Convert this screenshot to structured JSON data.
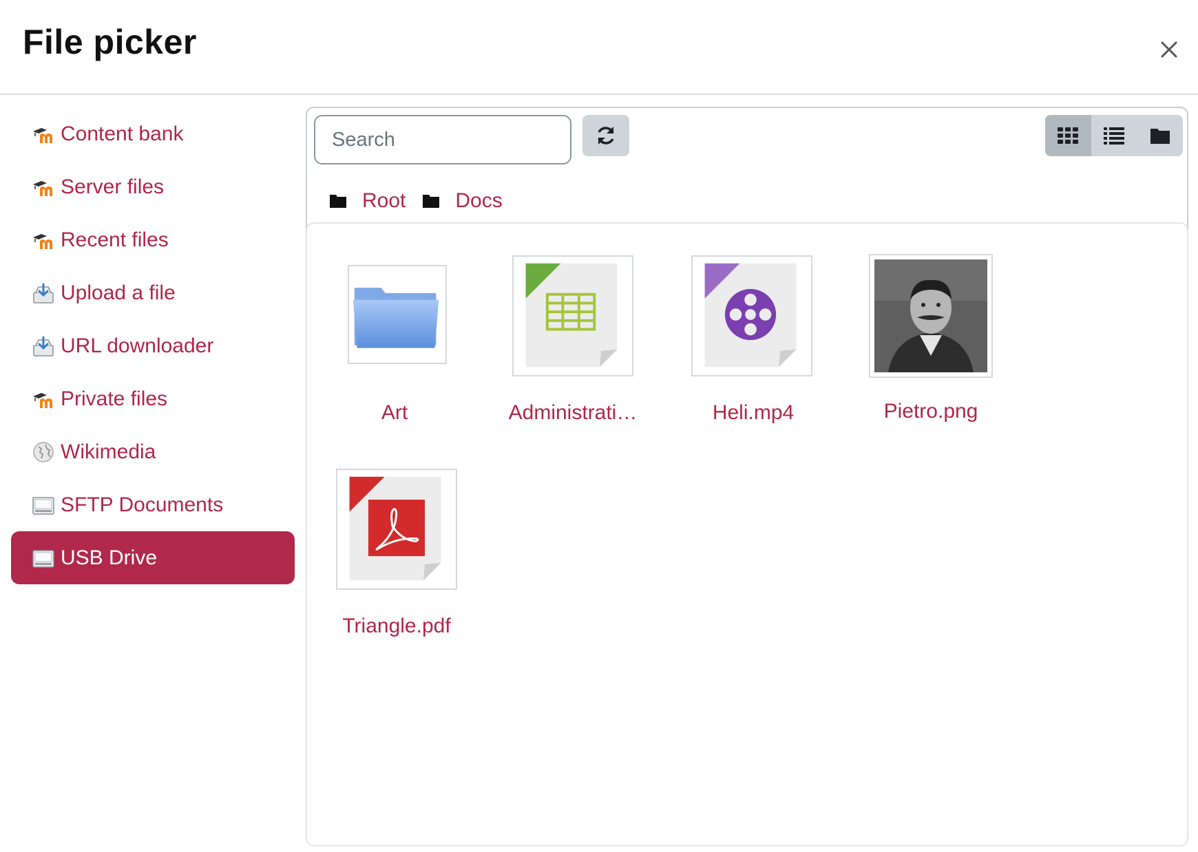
{
  "dialog": {
    "title": "File picker",
    "close_icon": "close-icon"
  },
  "sidebar": {
    "items": [
      {
        "label": "Content bank",
        "icon": "moodle-icon",
        "active": false
      },
      {
        "label": "Server files",
        "icon": "moodle-icon",
        "active": false
      },
      {
        "label": "Recent files",
        "icon": "moodle-icon",
        "active": false
      },
      {
        "label": "Upload a file",
        "icon": "upload-icon",
        "active": false
      },
      {
        "label": "URL downloader",
        "icon": "upload-icon",
        "active": false
      },
      {
        "label": "Private files",
        "icon": "moodle-icon",
        "active": false
      },
      {
        "label": "Wikimedia",
        "icon": "wikimedia-icon",
        "active": false
      },
      {
        "label": "SFTP Documents",
        "icon": "drive-icon",
        "active": false
      },
      {
        "label": "USB Drive",
        "icon": "drive-icon",
        "active": true
      }
    ]
  },
  "toolbar": {
    "search_placeholder": "Search",
    "search_value": "",
    "refresh_icon": "refresh-icon",
    "views": [
      {
        "icon": "grid-view-icon",
        "active": true
      },
      {
        "icon": "list-view-icon",
        "active": false
      },
      {
        "icon": "folder-view-icon",
        "active": false
      }
    ]
  },
  "breadcrumb": [
    {
      "label": "Root",
      "icon": "folder-icon"
    },
    {
      "label": "Docs",
      "icon": "folder-icon"
    }
  ],
  "files": [
    {
      "name": "Art",
      "type": "folder"
    },
    {
      "name": "Administrati…",
      "type": "spreadsheet"
    },
    {
      "name": "Heli.mp4",
      "type": "video"
    },
    {
      "name": "Pietro.png",
      "type": "image"
    },
    {
      "name": "Triangle.pdf",
      "type": "pdf"
    }
  ],
  "colors": {
    "accent": "#b0264a",
    "active_bg": "#b0294a"
  }
}
